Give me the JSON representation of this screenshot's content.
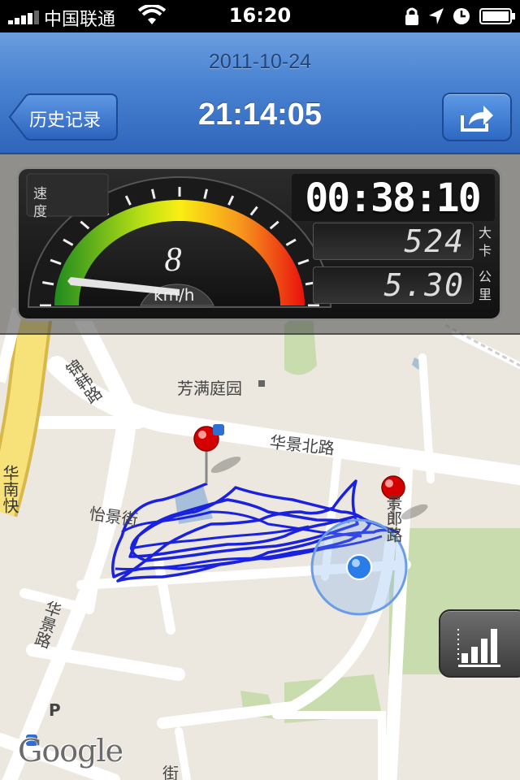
{
  "status_bar": {
    "carrier": "中国联通",
    "time": "16:20",
    "icons": [
      "signal-icon",
      "wifi-icon",
      "lock-rotation-icon",
      "location-icon",
      "alarm-icon",
      "battery-icon"
    ]
  },
  "nav": {
    "date": "2011-10-24",
    "time": "21:14:05",
    "back_label": "历史记录",
    "share_icon": "share-icon"
  },
  "dashboard": {
    "speed_label": "速度",
    "speed_value": "8",
    "speed_unit": "km/h",
    "elapsed": "00:38:10",
    "calories_value": "524",
    "calories_unit": "大卡",
    "distance_value": "5.30",
    "distance_unit": "公里"
  },
  "map": {
    "labels": {
      "garden": "芳满庭园",
      "road_north": "华景北路",
      "road_jinhan": "锦韩路",
      "road_yijing": "怡景街",
      "road_huajing": "华景路",
      "road_huanan": "华南快",
      "road_jingtao": "景郎路",
      "road_bottom": "街",
      "parking": "P"
    },
    "logo": "Google",
    "chart_button_icon": "bar-chart-icon"
  },
  "colors": {
    "nav_blue": "#3b74c8",
    "track_blue": "#1a22e0",
    "pin_red": "#d40000",
    "gauge_orange": "#f46b0a"
  }
}
